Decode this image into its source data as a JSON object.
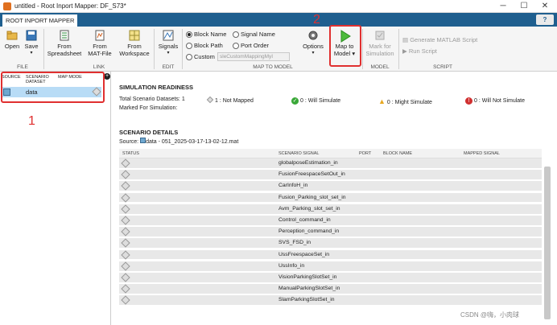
{
  "window": {
    "title": "untitled - Root Inport Mapper: DF_S73*"
  },
  "tab": {
    "label": "ROOT INPORT MAPPER",
    "help": "?"
  },
  "toolstrip": {
    "open": "Open",
    "save": "Save",
    "file_section": "FILE",
    "from_spreadsheet_1": "From",
    "from_spreadsheet_2": "Spreadsheet",
    "from_matfile_1": "From",
    "from_matfile_2": "MAT-File",
    "from_workspace_1": "From",
    "from_workspace_2": "Workspace",
    "link_section": "LINK",
    "signals": "Signals",
    "edit_section": "EDIT",
    "block_name": "Block Name",
    "signal_name": "Signal Name",
    "block_path": "Block Path",
    "port_order": "Port Order",
    "custom": "Custom",
    "custom_value": "sleCustomMappingMyI",
    "options": "Options",
    "map_to_model_1": "Map to",
    "map_to_model_2": "Model",
    "map_section": "MAP TO MODEL",
    "mark_sim_1": "Mark for",
    "mark_sim_2": "Simulation",
    "model_section": "MODEL",
    "gen_script": "Generate MATLAB Script",
    "run_script": "Run Script",
    "script_section": "SCRIPT"
  },
  "annotations": {
    "one": "1",
    "two": "2"
  },
  "left_panel": {
    "col_source": "SOURCE",
    "col_scenario_1": "SCENARIO",
    "col_scenario_2": "DATASET",
    "col_map_mode": "MAP MODE",
    "dataset": "data"
  },
  "readiness": {
    "title": "SIMULATION READINESS",
    "total": "Total Scenario Datasets: 1",
    "marked": "Marked For Simulation:",
    "not_mapped": "1 : Not Mapped",
    "will_sim": "0 : Will Simulate",
    "might_sim": "0 : Might Simulate",
    "will_not": "0 : Will Not Simulate"
  },
  "details": {
    "title": "SCENARIO DETAILS",
    "source_label": "Source:",
    "source_value": "data - 051_2025-03-17-13-02-12.mat",
    "columns": [
      "STATUS",
      "SCENARIO SIGNAL",
      "PORT",
      "BLOCK NAME",
      "MAPPED SIGNAL"
    ],
    "signals": [
      "globalposeEstimation_in",
      "FusionFreespaceSetOut_in",
      "CarInfoH_in",
      "Fusion_Parking_slot_set_in",
      "Avm_Parking_slot_set_in",
      "Control_command_in",
      "Perception_command_in",
      "SVS_FSD_in",
      "UssFreespaceSet_in",
      "UssInfo_in",
      "VisionParkingSlotSet_in",
      "ManualParkingSlotSet_in",
      "SlamParkingSlotSet_in"
    ]
  },
  "watermark": "CSDN @嗨，小肉球",
  "colors": {
    "accent": "#1f5f8f",
    "annotation": "#e03030",
    "selection": "#b8dcf6"
  }
}
